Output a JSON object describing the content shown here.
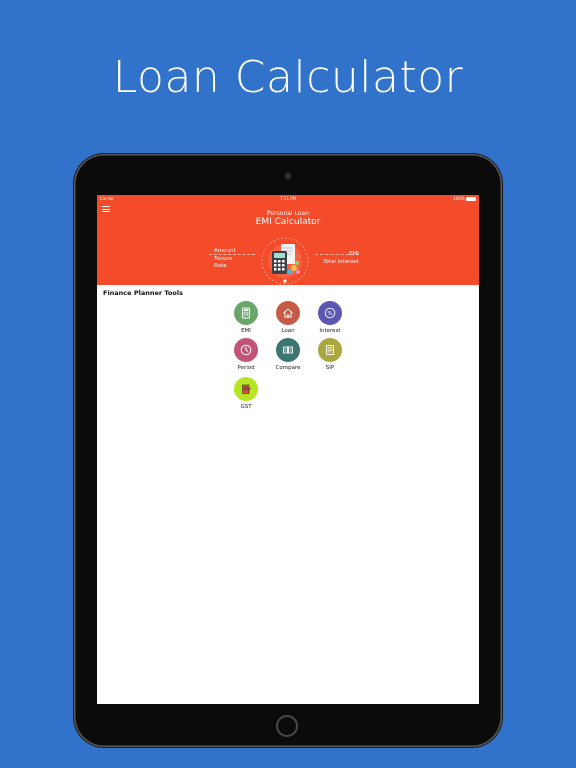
{
  "headline": "Loan Calculator",
  "statusbar": {
    "carrier": "Carrier",
    "time": "7:11 PM",
    "battery": "100%"
  },
  "banner": {
    "subtitle": "Personal Loan",
    "title": "EMI Calculator",
    "left_lines": [
      "Amount",
      "Tenure",
      "Rate"
    ],
    "right_lines": [
      "EMI",
      "Total Interest"
    ]
  },
  "section_title": "Finance Planner Tools",
  "tools": [
    {
      "label": "EMI",
      "icon": "calculator-icon",
      "color": "#6aa56a"
    },
    {
      "label": "Loan",
      "icon": "home-icon",
      "color": "#c55b46"
    },
    {
      "label": "Interest",
      "icon": "percent-icon",
      "color": "#5d57b4"
    },
    {
      "label": "Period",
      "icon": "clock-icon",
      "color": "#c45378"
    },
    {
      "label": "Compare",
      "icon": "compare-icon",
      "color": "#3d7570"
    },
    {
      "label": "SIP",
      "icon": "document-icon",
      "color": "#aaa640"
    },
    {
      "label": "GST",
      "icon": "invoice-icon",
      "color": "#b6e523"
    }
  ],
  "colors": {
    "background": "#3172cb",
    "accent": "#f44b2a"
  }
}
